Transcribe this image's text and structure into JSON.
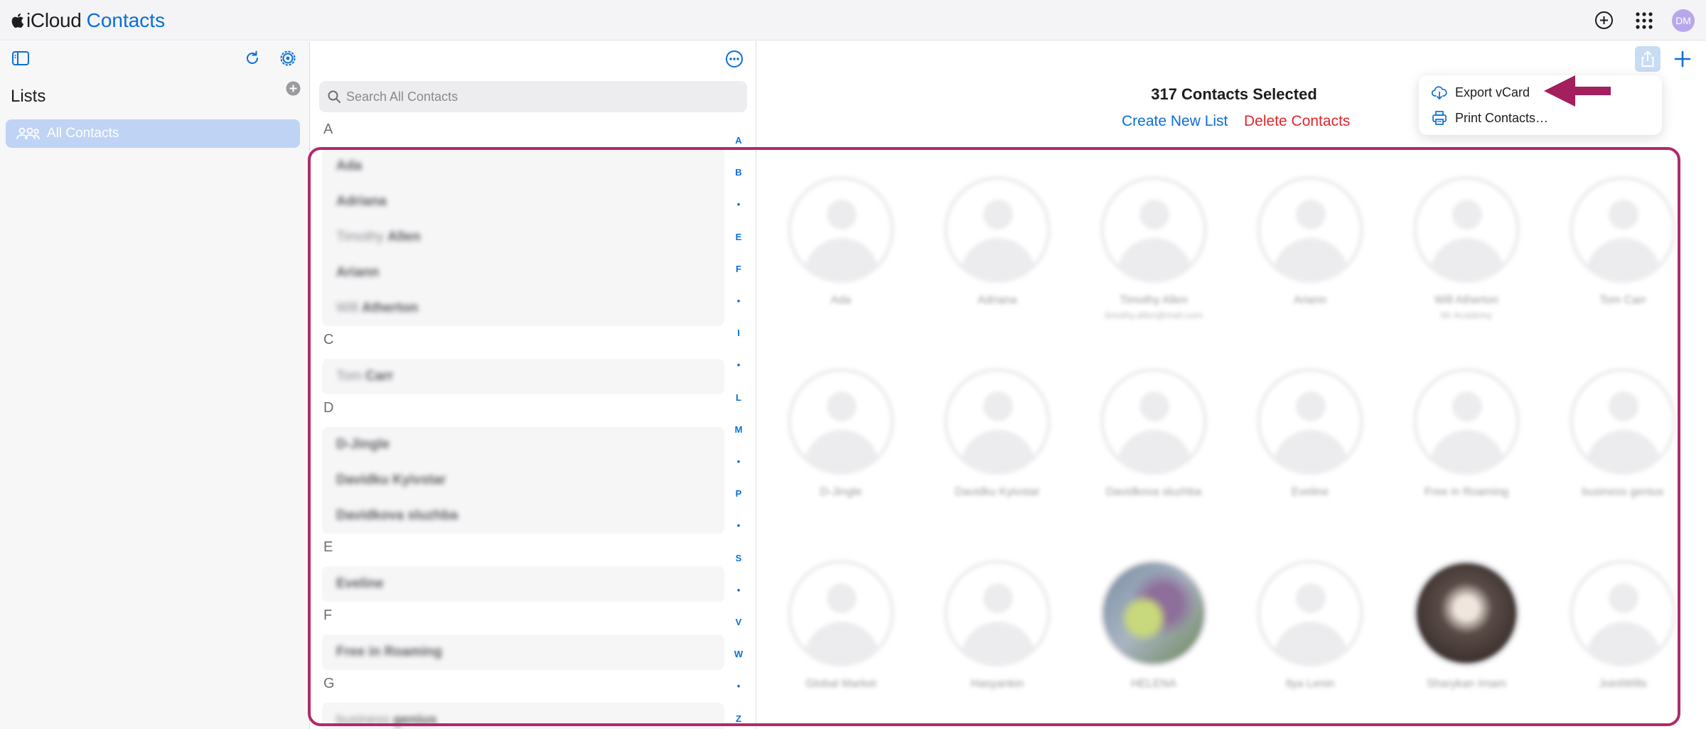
{
  "header": {
    "brand_icloud": "iCloud",
    "brand_contacts": "Contacts",
    "avatar_initials": "DM",
    "accent_color": "#0a6fd6"
  },
  "sidebar": {
    "title": "Lists",
    "items": [
      {
        "label": "All Contacts",
        "selected": true
      }
    ]
  },
  "list": {
    "search_placeholder": "Search All Contacts",
    "sections": [
      {
        "letter": "A",
        "rows": [
          {
            "first": "",
            "last": "Ada"
          },
          {
            "first": "",
            "last": "Adriana"
          },
          {
            "first": "Timothy",
            "last": "Allen"
          },
          {
            "first": "",
            "last": "Ariann"
          },
          {
            "first": "Will",
            "last": "Atherton"
          }
        ]
      },
      {
        "letter": "C",
        "rows": [
          {
            "first": "Tom",
            "last": "Carr"
          }
        ]
      },
      {
        "letter": "D",
        "rows": [
          {
            "first": "",
            "last": "D-Jingle"
          },
          {
            "first": "",
            "last": "Davidku Kyivstar"
          },
          {
            "first": "",
            "last": "Davidkova sluzhba"
          }
        ]
      },
      {
        "letter": "E",
        "rows": [
          {
            "first": "",
            "last": "Eveline"
          }
        ]
      },
      {
        "letter": "F",
        "rows": [
          {
            "first": "",
            "last": "Free in Roaming"
          }
        ]
      },
      {
        "letter": "G",
        "rows": [
          {
            "first": "business",
            "last": "genius"
          }
        ]
      }
    ],
    "index_letters": [
      "A",
      "B",
      "•",
      "E",
      "F",
      "•",
      "I",
      "•",
      "L",
      "M",
      "•",
      "P",
      "•",
      "S",
      "•",
      "V",
      "W",
      "•",
      "Z"
    ]
  },
  "main": {
    "selected_count": "317 Contacts Selected",
    "create_list": "Create New List",
    "delete_contacts": "Delete Contacts",
    "delete_color": "#e0262b",
    "cards": [
      {
        "name": "Ada",
        "sub": ""
      },
      {
        "name": "Adriana",
        "sub": ""
      },
      {
        "name": "Timothy Allen",
        "sub": "timothy.allen@mail.com"
      },
      {
        "name": "Ariann",
        "sub": ""
      },
      {
        "name": "Will Atherton",
        "sub": "Mr Academy"
      },
      {
        "name": "Tom Carr",
        "sub": ""
      },
      {
        "name": "D-Jingle",
        "sub": ""
      },
      {
        "name": "Davidku Kyivstar",
        "sub": ""
      },
      {
        "name": "Davidkova sluzhba",
        "sub": ""
      },
      {
        "name": "Eveline",
        "sub": ""
      },
      {
        "name": "Free in Roaming",
        "sub": ""
      },
      {
        "name": "business genius",
        "sub": ""
      },
      {
        "name": "Global Market",
        "sub": ""
      },
      {
        "name": "Hasyankin",
        "sub": ""
      },
      {
        "name": "HELENA",
        "sub": ""
      },
      {
        "name": "Ilya Lenin",
        "sub": ""
      },
      {
        "name": "Sharykan Imam",
        "sub": ""
      },
      {
        "name": "JointWills",
        "sub": ""
      }
    ]
  },
  "share_menu": {
    "items": [
      {
        "label": "Export vCard",
        "icon": "cloud-download-icon"
      },
      {
        "label": "Print Contacts…",
        "icon": "printer-icon"
      }
    ]
  },
  "annotation": {
    "highlight_color": "#b02a6b"
  }
}
